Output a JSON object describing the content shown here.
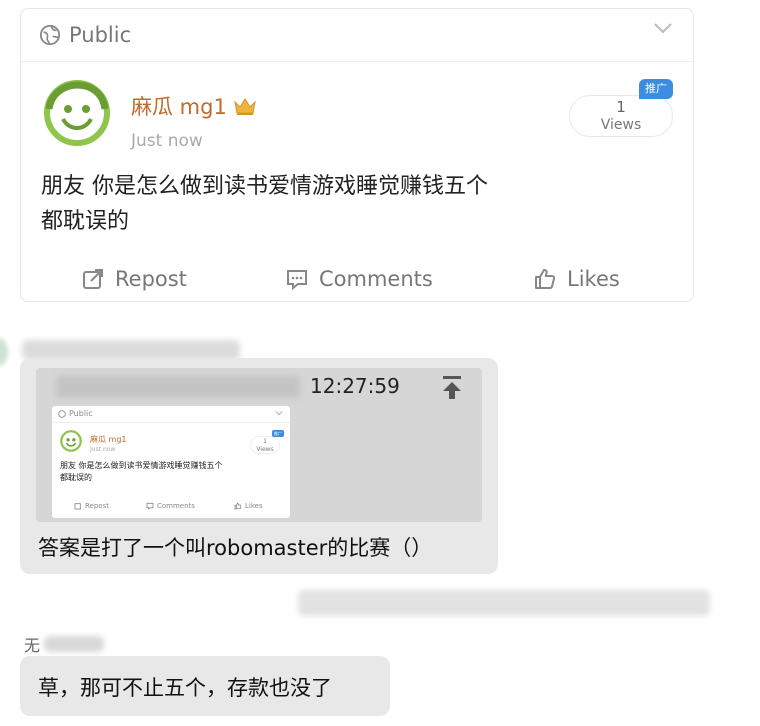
{
  "post": {
    "visibility": "Public",
    "username": "麻瓜 mg1",
    "timestamp": "Just now",
    "views_count": "1",
    "views_label": "Views",
    "promo_badge": "推广",
    "text_line1": "朋友 你是怎么做到读书爱情游戏睡觉赚钱五个",
    "text_line2": "都耽误的",
    "actions": {
      "repost": "Repost",
      "comments": "Comments",
      "likes": "Likes"
    }
  },
  "chat": {
    "message1": {
      "quote_time": "12:27:59",
      "answer": "答案是打了一个叫robomaster的比赛（）"
    },
    "message2": {
      "sender_initial": "无",
      "text": "草，那可不止五个，存款也没了"
    }
  },
  "icons": [
    "globe-icon",
    "chevron-down-icon",
    "avatar-smiley-icon",
    "crown-icon",
    "repost-icon",
    "comments-icon",
    "likes-icon",
    "jump-to-quote-icon"
  ],
  "colors": {
    "username": "#c06a2c",
    "promo_badge": "#3b8de0",
    "bubble": "#e8e8e8",
    "quote_bg": "#d6d6d6",
    "avatar_green": "#8ec54a"
  }
}
